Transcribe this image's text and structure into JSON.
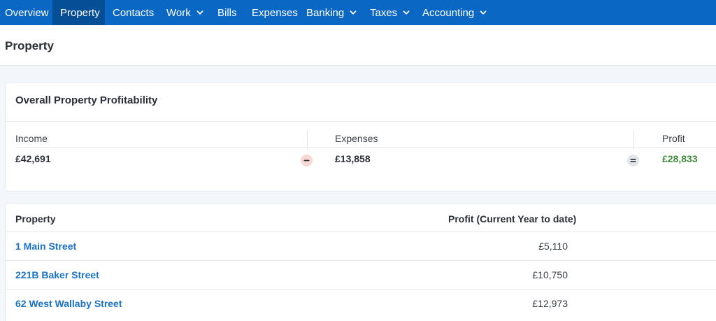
{
  "nav": {
    "items": [
      {
        "label": "Overview"
      },
      {
        "label": "Property"
      },
      {
        "label": "Contacts"
      },
      {
        "label": "Work"
      },
      {
        "label": "Bills"
      },
      {
        "label": "Expenses"
      },
      {
        "label": "Banking"
      },
      {
        "label": "Taxes"
      },
      {
        "label": "Accounting"
      }
    ],
    "active_color": "#064e96",
    "bar_color": "#0a67c3"
  },
  "page": {
    "title": "Property"
  },
  "summary": {
    "title": "Overall Property Profitability",
    "income_label": "Income",
    "income_value": "£42,691",
    "expenses_label": "Expenses",
    "expenses_value": "£13,858",
    "profit_label": "Profit",
    "profit_value": "£28,833",
    "minus_icon": "minus-icon",
    "equals_icon": "equals-icon",
    "profit_color": "#3c8a3a"
  },
  "table": {
    "col_property": "Property",
    "col_profit": "Profit (Current Year to date)",
    "rows": [
      {
        "name": "1 Main Street",
        "profit": "£5,110"
      },
      {
        "name": "221B Baker Street",
        "profit": "£10,750"
      },
      {
        "name": "62 West Wallaby Street",
        "profit": "£12,973"
      }
    ],
    "link_color": "#1a72c6"
  }
}
